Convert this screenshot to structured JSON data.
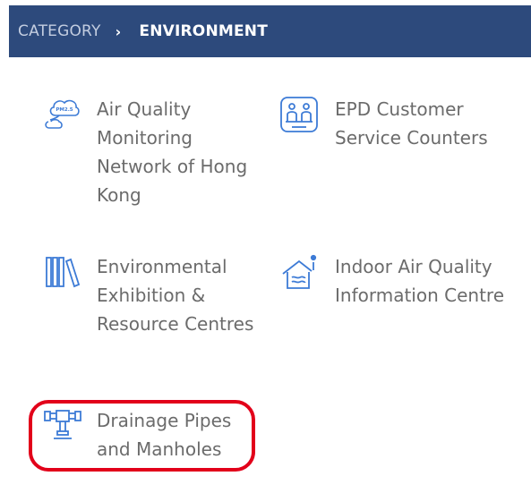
{
  "breadcrumb": {
    "category": "CATEGORY",
    "separator": "›",
    "current": "ENVIRONMENT"
  },
  "items": [
    {
      "label": "Air Quality Monitoring Network of Hong Kong",
      "icon": "cloud-icon"
    },
    {
      "label": "EPD Customer Service Counters",
      "icon": "service-counter-icon"
    },
    {
      "label": "Environmental Exhibition & Resource Centres",
      "icon": "books-icon"
    },
    {
      "label": "Indoor Air Quality Information Centre",
      "icon": "house-info-icon"
    },
    {
      "label": "Drainage Pipes and Manholes",
      "icon": "pipe-icon",
      "highlighted": true
    }
  ],
  "colors": {
    "header_bg": "#2d4a7c",
    "icon": "#3d7bd6",
    "label": "#6b6b6b",
    "highlight": "#e2001a"
  },
  "icon_texts": {
    "cloud": "PM2.5"
  }
}
